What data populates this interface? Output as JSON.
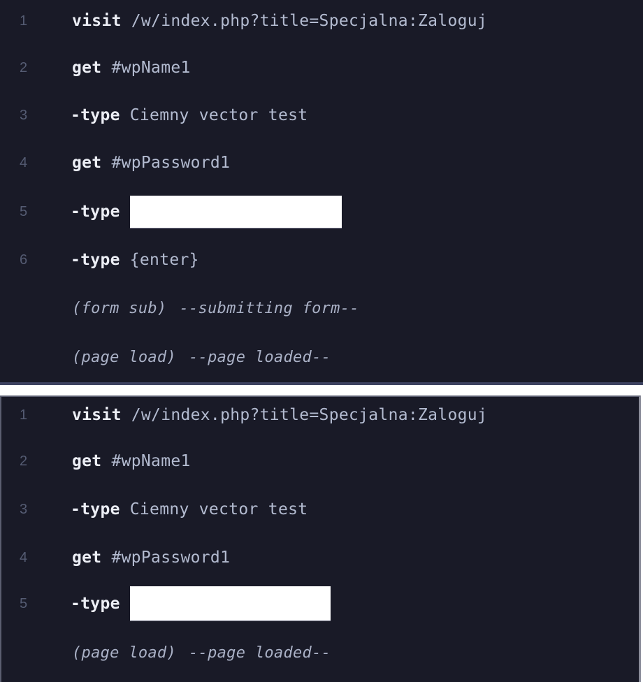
{
  "panels": [
    {
      "id": "top",
      "rows": [
        {
          "line": "1",
          "command": "visit",
          "argument": "/w/index.php?title=Specjalna:Zaloguj"
        },
        {
          "line": "2",
          "command": "get",
          "argument": "#wpName1"
        },
        {
          "line": "3",
          "command": "-type",
          "argument": "Ciemny vector test"
        },
        {
          "line": "4",
          "command": "get",
          "argument": "#wpPassword1"
        },
        {
          "line": "5",
          "command": "-type",
          "argument": "[redacted]"
        },
        {
          "line": "6",
          "command": "-type",
          "argument": "{enter}"
        }
      ],
      "events": [
        {
          "label": "(form sub)",
          "message": "--submitting form--"
        },
        {
          "label": "(page load)",
          "message": "--page loaded--"
        }
      ]
    },
    {
      "id": "bottom",
      "rows": [
        {
          "line": "1",
          "command": "visit",
          "argument": "/w/index.php?title=Specjalna:Zaloguj"
        },
        {
          "line": "2",
          "command": "get",
          "argument": "#wpName1"
        },
        {
          "line": "3",
          "command": "-type",
          "argument": "Ciemny vector test"
        },
        {
          "line": "4",
          "command": "get",
          "argument": "#wpPassword1"
        },
        {
          "line": "5",
          "command": "-type",
          "argument": "[redacted]"
        }
      ],
      "events": [
        {
          "label": "(page load)",
          "message": "--page loaded--"
        }
      ]
    }
  ],
  "colors": {
    "background": "#191a27",
    "command": "#eceef5",
    "argument": "#b3bbd0",
    "line_number": "#555c73",
    "event": "#aab1c6",
    "redaction": "#ffffff"
  }
}
